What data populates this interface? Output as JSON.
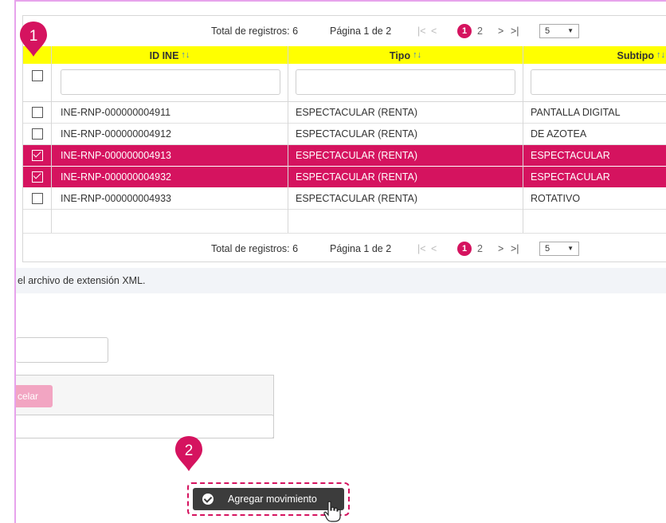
{
  "pager_top": {
    "total": "Total de registros: 6",
    "page_info": "Página 1 de 2",
    "first": "|<",
    "prev": "<",
    "pages": [
      "1",
      "2"
    ],
    "next": ">",
    "last": ">|",
    "page_size": "5"
  },
  "pager_bottom": {
    "total": "Total de registros: 6",
    "page_info": "Página 1 de 2",
    "first": "|<",
    "prev": "<",
    "pages": [
      "1",
      "2"
    ],
    "next": ">",
    "last": ">|",
    "page_size": "5"
  },
  "columns": [
    {
      "label": "ID INE",
      "sort": "↑↓"
    },
    {
      "label": "Tipo",
      "sort": "↑↓"
    },
    {
      "label": "Subtipo",
      "sort": "↑↓"
    }
  ],
  "rows": [
    {
      "id": "INE-RNP-000000004911",
      "tipo": "ESPECTACULAR (RENTA)",
      "subtipo": "PANTALLA DIGITAL",
      "checked": false
    },
    {
      "id": "INE-RNP-000000004912",
      "tipo": "ESPECTACULAR (RENTA)",
      "subtipo": "DE AZOTEA",
      "checked": false
    },
    {
      "id": "INE-RNP-000000004913",
      "tipo": "ESPECTACULAR (RENTA)",
      "subtipo": "ESPECTACULAR",
      "checked": true
    },
    {
      "id": "INE-RNP-000000004932",
      "tipo": "ESPECTACULAR (RENTA)",
      "subtipo": "ESPECTACULAR",
      "checked": true
    },
    {
      "id": "INE-RNP-000000004933",
      "tipo": "ESPECTACULAR (RENTA)",
      "subtipo": "ROTATIVO",
      "checked": false
    }
  ],
  "note": "el archivo de extensión XML.",
  "cancel_label": "celar",
  "agregar_label": "Agregar movimiento",
  "markers": {
    "one": "1",
    "two": "2"
  },
  "colors": {
    "accent": "#d5135f",
    "header": "#ffff00",
    "frame": "#e7a3ec"
  }
}
